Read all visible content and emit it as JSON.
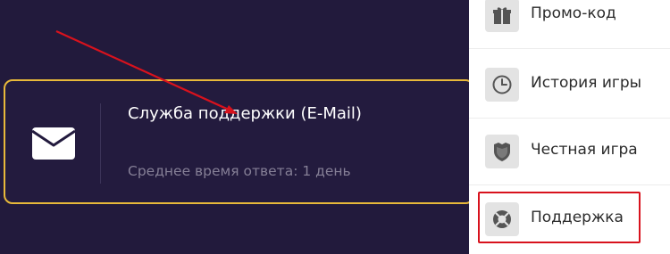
{
  "support_card": {
    "title": "Служба поддержки (E-Mail)",
    "subtitle": "Среднее время ответа: 1 день",
    "icon": "envelope-icon"
  },
  "menu": {
    "items": [
      {
        "label": "Промо-код",
        "icon": "gift-icon"
      },
      {
        "label": "История игры",
        "icon": "clock-icon"
      },
      {
        "label": "Честная игра",
        "icon": "shield-icon"
      },
      {
        "label": "Поддержка",
        "icon": "lifebuoy-icon"
      }
    ]
  },
  "colors": {
    "background": "#221a3c",
    "card_border": "#e8b93a",
    "highlight": "#d8121d",
    "arrow": "#d8121d"
  }
}
